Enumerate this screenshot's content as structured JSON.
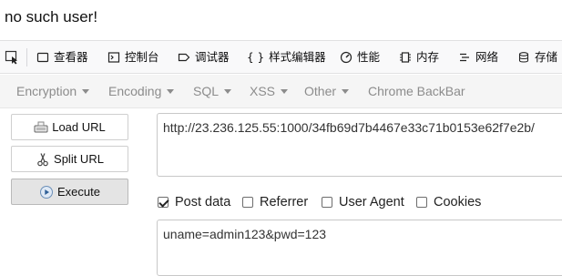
{
  "page": {
    "message": "no such user!"
  },
  "devtools": {
    "tabs": [
      {
        "label": "查看器",
        "icon": "inspector-icon"
      },
      {
        "label": "控制台",
        "icon": "console-icon"
      },
      {
        "label": "调试器",
        "icon": "debugger-icon"
      },
      {
        "label": "样式编辑器",
        "icon": "style-editor-icon"
      },
      {
        "label": "性能",
        "icon": "performance-icon"
      },
      {
        "label": "内存",
        "icon": "memory-icon"
      },
      {
        "label": "网络",
        "icon": "network-icon"
      },
      {
        "label": "存储",
        "icon": "storage-icon"
      }
    ],
    "picker_icon": "element-picker-icon"
  },
  "hackbar": {
    "menu": [
      {
        "label": "Encryption",
        "dropdown": true
      },
      {
        "label": "Encoding",
        "dropdown": true
      },
      {
        "label": "SQL",
        "dropdown": true
      },
      {
        "label": "XSS",
        "dropdown": true
      },
      {
        "label": "Other",
        "dropdown": true
      },
      {
        "label": "Chrome BackBar",
        "dropdown": false
      }
    ],
    "buttons": {
      "load_url": "Load URL",
      "split_url": "Split URL",
      "execute": "Execute"
    },
    "url_value": "http://23.236.125.55:1000/34fb69d7b4467e33c71b0153e62f7e2b/",
    "options": [
      {
        "label": "Post data",
        "checked": true
      },
      {
        "label": "Referrer",
        "checked": false
      },
      {
        "label": "User Agent",
        "checked": false
      },
      {
        "label": "Cookies",
        "checked": false
      }
    ],
    "post_data_value": "uname=admin123&pwd=123"
  }
}
